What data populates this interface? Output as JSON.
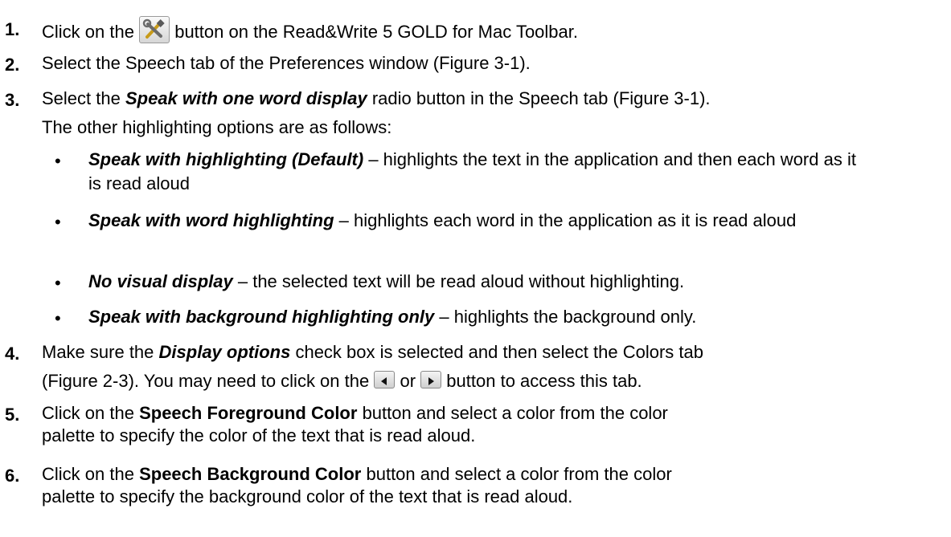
{
  "steps": [
    {
      "num": "1.",
      "pre": "Click on the",
      "post": "button on the Read&Write 5 GOLD for Mac Toolbar.",
      "icon": "tools-icon"
    },
    {
      "num": "2.",
      "text": "Select the Speech tab of the Preferences window (Figure 3-1)."
    },
    {
      "num": "3.",
      "pre": "Select the",
      "bold": "Speak with one word display",
      "post": "radio button in the Speech tab (Figure 3-1).",
      "line2": "The other highlighting options are as follows:"
    },
    {
      "num": "4.",
      "pre": "Make sure the",
      "bold": "Display options",
      "post": "check box is selected and then select the Colors tab",
      "line2_pre": "(Figure 2-3). You may need to click on the",
      "or": "or",
      "line2_post": "button to access this tab.",
      "icons": [
        "left-arrow-icon",
        "right-arrow-icon"
      ]
    },
    {
      "num": "5.",
      "pre": "Click on the",
      "bold": "Speech Foreground Color",
      "post": "button and select a color from the color",
      "line2": "palette to specify the color of the text that is read aloud."
    },
    {
      "num": "6.",
      "pre": "Click on the",
      "bold": "Speech Background Color",
      "post": "button and select a color from the color",
      "line2": "palette to specify the background color of the text that is read aloud."
    }
  ],
  "bullets": [
    {
      "symbol": "•",
      "bold": "Speak with highlighting (Default)",
      "rest": "– highlights the text in the application and then each word as it is read aloud"
    },
    {
      "symbol": "•",
      "bold": "Speak with word highlighting",
      "rest": "– highlights each word in the application as it is read aloud"
    },
    {
      "symbol": "•",
      "bold": "No visual display",
      "rest": "– the selected text will be read aloud without highlighting."
    },
    {
      "symbol": "•",
      "bold": "Speak with background highlighting only",
      "rest": "– highlights the background only."
    }
  ]
}
